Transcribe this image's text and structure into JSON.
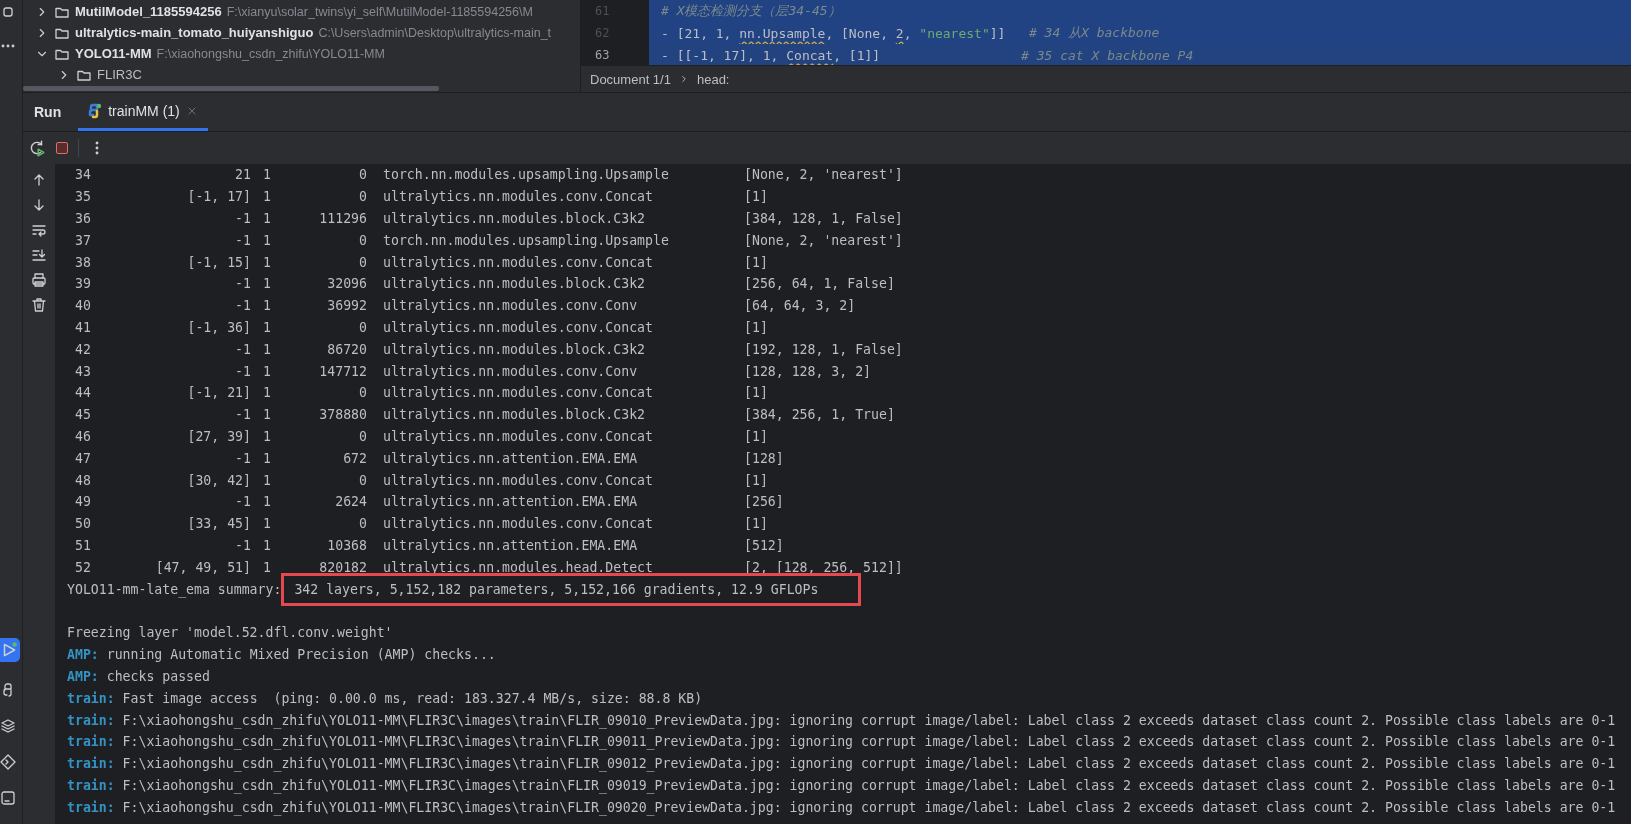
{
  "project_tree": {
    "items": [
      {
        "name": "MutilModel_1185594256",
        "path": "F:\\xianyu\\solar_twins\\yi_self\\MutilModel-1185594256\\M",
        "expanded": false
      },
      {
        "name": "ultralytics-main_tomato_huiyanshiguo",
        "path": "C:\\Users\\admin\\Desktop\\ultralytics-main_t",
        "expanded": false
      },
      {
        "name": "YOLO11-MM",
        "path": "F:\\xiaohongshu_csdn_zhifu\\YOLO11-MM",
        "expanded": true,
        "children": [
          {
            "name": "FLIR3C",
            "expanded": false
          }
        ]
      }
    ]
  },
  "editor": {
    "lines": [
      {
        "number": "61",
        "current": false,
        "segments": [
          {
            "text": "# X模态检测分支（层34-45）",
            "kind": "comment"
          }
        ]
      },
      {
        "number": "62",
        "current": false,
        "segments": [
          {
            "text": "- [21, 1, ",
            "kind": "plain"
          },
          {
            "text": "nn.Upsample",
            "kind": "warn"
          },
          {
            "text": ", [None, ",
            "kind": "plain"
          },
          {
            "text": "2",
            "kind": "warn"
          },
          {
            "text": ", ",
            "kind": "plain"
          },
          {
            "text": "\"nearest\"",
            "kind": "string"
          },
          {
            "text": "]]   ",
            "kind": "plain"
          },
          {
            "text": "# 34 从X backbone",
            "kind": "comment"
          }
        ]
      },
      {
        "number": "63",
        "current": true,
        "segments": [
          {
            "text": "- [[-1, 17], 1, ",
            "kind": "plain"
          },
          {
            "text": "Concat",
            "kind": "warn"
          },
          {
            "text": ", [1]]                  ",
            "kind": "plain"
          },
          {
            "text": "# 35 cat X backbone P4",
            "kind": "comment"
          }
        ]
      }
    ],
    "breadcrumb": [
      "Document 1/1",
      "head:"
    ]
  },
  "run_panel": {
    "title": "Run",
    "tabs": [
      {
        "label": "trainMM (1)",
        "selected": true
      }
    ]
  },
  "console": {
    "layers": [
      {
        "index": "34",
        "from": "21",
        "n": "1",
        "params": "0",
        "module": "torch.nn.modules.upsampling.Upsample",
        "arguments": "[None, 2, 'nearest']"
      },
      {
        "index": "35",
        "from": "[-1, 17]",
        "n": "1",
        "params": "0",
        "module": "ultralytics.nn.modules.conv.Concat",
        "arguments": "[1]"
      },
      {
        "index": "36",
        "from": "-1",
        "n": "1",
        "params": "111296",
        "module": "ultralytics.nn.modules.block.C3k2",
        "arguments": "[384, 128, 1, False]"
      },
      {
        "index": "37",
        "from": "-1",
        "n": "1",
        "params": "0",
        "module": "torch.nn.modules.upsampling.Upsample",
        "arguments": "[None, 2, 'nearest']"
      },
      {
        "index": "38",
        "from": "[-1, 15]",
        "n": "1",
        "params": "0",
        "module": "ultralytics.nn.modules.conv.Concat",
        "arguments": "[1]"
      },
      {
        "index": "39",
        "from": "-1",
        "n": "1",
        "params": "32096",
        "module": "ultralytics.nn.modules.block.C3k2",
        "arguments": "[256, 64, 1, False]"
      },
      {
        "index": "40",
        "from": "-1",
        "n": "1",
        "params": "36992",
        "module": "ultralytics.nn.modules.conv.Conv",
        "arguments": "[64, 64, 3, 2]"
      },
      {
        "index": "41",
        "from": "[-1, 36]",
        "n": "1",
        "params": "0",
        "module": "ultralytics.nn.modules.conv.Concat",
        "arguments": "[1]"
      },
      {
        "index": "42",
        "from": "-1",
        "n": "1",
        "params": "86720",
        "module": "ultralytics.nn.modules.block.C3k2",
        "arguments": "[192, 128, 1, False]"
      },
      {
        "index": "43",
        "from": "-1",
        "n": "1",
        "params": "147712",
        "module": "ultralytics.nn.modules.conv.Conv",
        "arguments": "[128, 128, 3, 2]"
      },
      {
        "index": "44",
        "from": "[-1, 21]",
        "n": "1",
        "params": "0",
        "module": "ultralytics.nn.modules.conv.Concat",
        "arguments": "[1]"
      },
      {
        "index": "45",
        "from": "-1",
        "n": "1",
        "params": "378880",
        "module": "ultralytics.nn.modules.block.C3k2",
        "arguments": "[384, 256, 1, True]"
      },
      {
        "index": "46",
        "from": "[27, 39]",
        "n": "1",
        "params": "0",
        "module": "ultralytics.nn.modules.conv.Concat",
        "arguments": "[1]"
      },
      {
        "index": "47",
        "from": "-1",
        "n": "1",
        "params": "672",
        "module": "ultralytics.nn.attention.EMA.EMA",
        "arguments": "[128]"
      },
      {
        "index": "48",
        "from": "[30, 42]",
        "n": "1",
        "params": "0",
        "module": "ultralytics.nn.modules.conv.Concat",
        "arguments": "[1]"
      },
      {
        "index": "49",
        "from": "-1",
        "n": "1",
        "params": "2624",
        "module": "ultralytics.nn.attention.EMA.EMA",
        "arguments": "[256]"
      },
      {
        "index": "50",
        "from": "[33, 45]",
        "n": "1",
        "params": "0",
        "module": "ultralytics.nn.modules.conv.Concat",
        "arguments": "[1]"
      },
      {
        "index": "51",
        "from": "-1",
        "n": "1",
        "params": "10368",
        "module": "ultralytics.nn.attention.EMA.EMA",
        "arguments": "[512]"
      },
      {
        "index": "52",
        "from": "[47, 49, 51]",
        "n": "1",
        "params": "820182",
        "module": "ultralytics.nn.modules.head.Detect",
        "arguments": "[2, [128, 256, 512]]"
      }
    ],
    "summary": {
      "model": "YOLO11-mm-late_ema summary:",
      "highlighted": "342 layers, 5,152,182 parameters, 5,152,166 gradients, 12.9 GFLOPs"
    },
    "lines": [
      {
        "text": "Freezing layer 'model.52.dfl.conv.weight'"
      },
      {
        "prefix": "AMP:",
        "text": "running Automatic Mixed Precision (AMP) checks..."
      },
      {
        "prefix": "AMP:",
        "text": "checks passed"
      },
      {
        "prefix": "train:",
        "text": "Fast image access  (ping: 0.00.0 ms, read: 183.327.4 MB/s, size: 88.8 KB)"
      },
      {
        "prefix": "train:",
        "text": "F:\\xiaohongshu_csdn_zhifu\\YOLO11-MM\\FLIR3C\\images\\train\\FLIR_09010_PreviewData.jpg: ignoring corrupt image/label: Label class 2 exceeds dataset class count 2. Possible class labels are 0-1"
      },
      {
        "prefix": "train:",
        "text": "F:\\xiaohongshu_csdn_zhifu\\YOLO11-MM\\FLIR3C\\images\\train\\FLIR_09011_PreviewData.jpg: ignoring corrupt image/label: Label class 2 exceeds dataset class count 2. Possible class labels are 0-1"
      },
      {
        "prefix": "train:",
        "text": "F:\\xiaohongshu_csdn_zhifu\\YOLO11-MM\\FLIR3C\\images\\train\\FLIR_09012_PreviewData.jpg: ignoring corrupt image/label: Label class 2 exceeds dataset class count 2. Possible class labels are 0-1"
      },
      {
        "prefix": "train:",
        "text": "F:\\xiaohongshu_csdn_zhifu\\YOLO11-MM\\FLIR3C\\images\\train\\FLIR_09019_PreviewData.jpg: ignoring corrupt image/label: Label class 2 exceeds dataset class count 2. Possible class labels are 0-1"
      },
      {
        "prefix": "train:",
        "text": "F:\\xiaohongshu_csdn_zhifu\\YOLO11-MM\\FLIR3C\\images\\train\\FLIR_09020_PreviewData.jpg: ignoring corrupt image/label: Label class 2 exceeds dataset class count 2. Possible class labels are 0-1"
      }
    ]
  }
}
